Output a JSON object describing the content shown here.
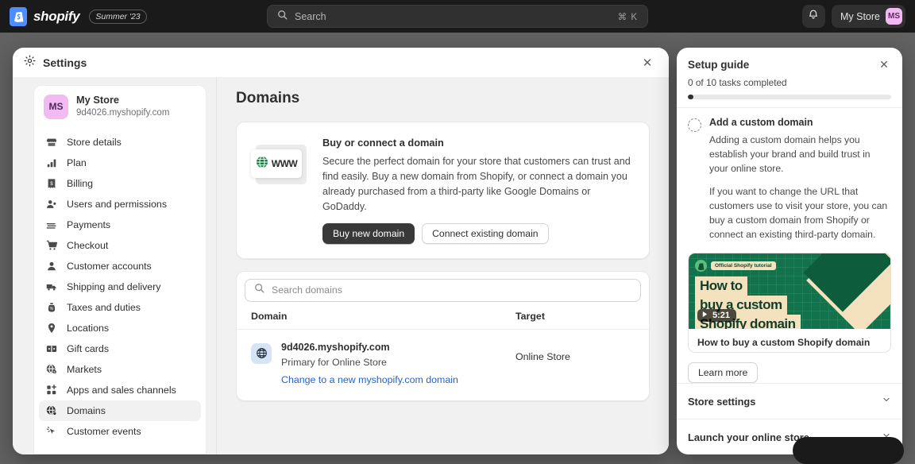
{
  "topbar": {
    "brand_name": "shopify",
    "version_pill": "Summer '23",
    "search_placeholder": "Search",
    "search_shortcut": "⌘ K",
    "bell_icon": "notification-bell-icon",
    "store_name": "My Store",
    "store_initials": "MS"
  },
  "modal": {
    "title": "Settings",
    "gear_icon": "gear-icon",
    "close_icon": "close-icon"
  },
  "sidebar": {
    "store_initials": "MS",
    "store_name": "My Store",
    "store_domain": "9d4026.myshopify.com",
    "items": [
      {
        "label": "Store details",
        "icon": "store-icon",
        "active": false
      },
      {
        "label": "Plan",
        "icon": "chart-bars-icon",
        "active": false
      },
      {
        "label": "Billing",
        "icon": "billing-receipt-icon",
        "active": false
      },
      {
        "label": "Users and permissions",
        "icon": "users-icon",
        "active": false
      },
      {
        "label": "Payments",
        "icon": "payments-card-icon",
        "active": false
      },
      {
        "label": "Checkout",
        "icon": "shopping-cart-icon",
        "active": false
      },
      {
        "label": "Customer accounts",
        "icon": "person-icon",
        "active": false
      },
      {
        "label": "Shipping and delivery",
        "icon": "truck-icon",
        "active": false
      },
      {
        "label": "Taxes and duties",
        "icon": "taxes-icon",
        "active": false
      },
      {
        "label": "Locations",
        "icon": "map-pin-icon",
        "active": false
      },
      {
        "label": "Gift cards",
        "icon": "gift-card-icon",
        "active": false
      },
      {
        "label": "Markets",
        "icon": "globe-dollar-icon",
        "active": false
      },
      {
        "label": "Apps and sales channels",
        "icon": "apps-grid-icon",
        "active": false
      },
      {
        "label": "Domains",
        "icon": "globe-icon",
        "active": true
      },
      {
        "label": "Customer events",
        "icon": "cursor-click-icon",
        "active": false
      }
    ]
  },
  "main": {
    "page_title": "Domains",
    "promo": {
      "art_label": "WWW",
      "globe_icon": "green-globe-icon",
      "heading": "Buy or connect a domain",
      "body": "Secure the perfect domain for your store that customers can trust and find easily. Buy a new domain from Shopify, or connect a domain you already purchased from a third-party like Google Domains or GoDaddy.",
      "primary_button": "Buy new domain",
      "secondary_button": "Connect existing domain"
    },
    "search_placeholder": "Search domains",
    "search_icon": "search-icon",
    "table": {
      "columns": [
        "Domain",
        "Target"
      ],
      "rows": [
        {
          "icon": "globe-icon",
          "name": "9d4026.myshopify.com",
          "subtitle": "Primary for Online Store",
          "link": "Change to a new myshopify.com domain",
          "target": "Online Store"
        }
      ]
    }
  },
  "guide": {
    "title": "Setup guide",
    "close_icon": "close-icon",
    "progress_text": "0 of 10 tasks completed",
    "progress_percent": 2,
    "task": {
      "status_icon": "dashed-circle-icon",
      "title": "Add a custom domain",
      "paragraphs": [
        "Adding a custom domain helps you establish your brand and build trust in your online store.",
        "If you want to change the URL that customers use to visit your store, you can buy a custom domain from Shopify or connect an existing third-party domain."
      ]
    },
    "video": {
      "badge_label": "Official Shopify tutorial",
      "badge_icon": "shopify-bag-icon",
      "title_lines": [
        "How to",
        "buy a custom",
        "Shopify domain"
      ],
      "duration": "5:21",
      "play_icon": "play-icon",
      "caption": "How to buy a custom Shopify domain"
    },
    "learn_more_button": "Learn more",
    "sections": [
      {
        "label": "Store settings",
        "chevron": "chevron-down-icon"
      },
      {
        "label": "Launch your online store",
        "chevron": "chevron-down-icon"
      }
    ]
  },
  "colors": {
    "brand_blue": "#4e8cff",
    "accent_link": "#2563c9",
    "primary_button": "#393939",
    "avatar_pink": "#f2b9f2",
    "video_green": "#12724b",
    "video_cream": "#f3e2bd"
  }
}
